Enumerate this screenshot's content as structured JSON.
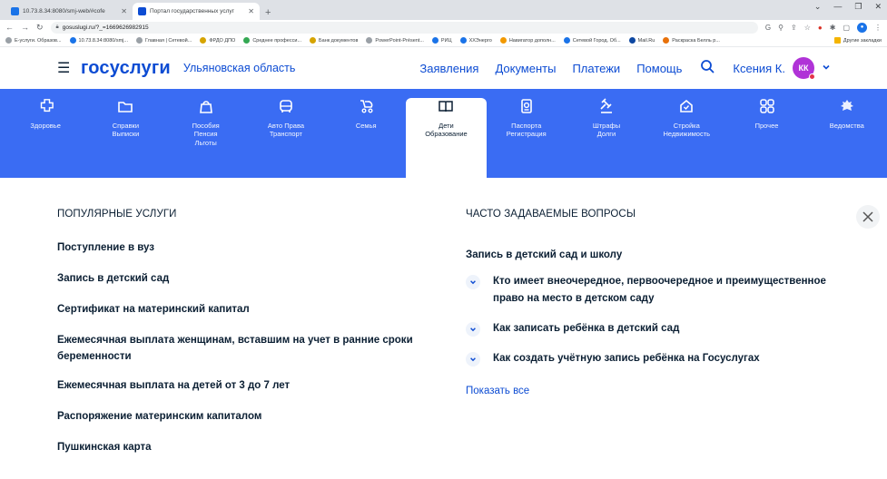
{
  "browser": {
    "tabs": [
      {
        "title": "10.73.8.34:8080/smj-web/#cofe",
        "active": false
      },
      {
        "title": "Портал государственных услуг",
        "active": true
      }
    ],
    "new_tab": "+",
    "url": "gosuslugi.ru/?_=1669626982915",
    "bookmarks": [
      "Е-услуги. Образов...",
      "10.73.8.34:8080/smj...",
      "Главная | Сетевой...",
      "ФРДО ДПО",
      "Среднее професси...",
      "Банк документов",
      "PowerPoint-Présent...",
      "РИЦ",
      "ХХЭнерго",
      "Навигатор дополн...",
      "Сетевой Город. Об...",
      "Mail.Ru",
      "Раскраска Белль р..."
    ],
    "other_bookmarks": "Другие закладки"
  },
  "header": {
    "logo": "госуслуги",
    "region": "Ульяновская область",
    "nav": [
      "Заявления",
      "Документы",
      "Платежи",
      "Помощь"
    ],
    "user_name": "Ксения К.",
    "avatar_initials": "КК"
  },
  "categories": [
    {
      "label": "Здоровье",
      "icon": "health-icon"
    },
    {
      "label": "Справки\nВыписки",
      "icon": "folder-icon"
    },
    {
      "label": "Пособия\nПенсия\nЛьготы",
      "icon": "bag-icon"
    },
    {
      "label": "Авто Права\nТранспорт",
      "icon": "car-icon"
    },
    {
      "label": "Семья",
      "icon": "stroller-icon"
    },
    {
      "label": "Дети\nОбразование",
      "icon": "book-icon",
      "active": true
    },
    {
      "label": "Паспорта\nРегистрация",
      "icon": "passport-icon"
    },
    {
      "label": "Штрафы\nДолги",
      "icon": "gavel-icon"
    },
    {
      "label": "Стройка\nНедвижимость",
      "icon": "home-icon"
    },
    {
      "label": "Прочее",
      "icon": "grid-icon"
    },
    {
      "label": "Ведомства",
      "icon": "emblem-icon"
    }
  ],
  "popular": {
    "title": "ПОПУЛЯРНЫЕ УСЛУГИ",
    "items": [
      "Поступление в вуз",
      "Запись в детский сад",
      "Сертификат на материнский капитал",
      "Ежемесячная выплата женщинам, вставшим на учет в ранние сроки беременности",
      "Ежемесячная выплата на детей от 3 до 7 лет",
      "Распоряжение материнским капиталом",
      "Пушкинская карта"
    ]
  },
  "faq": {
    "title": "ЧАСТО ЗАДАВАЕМЫЕ ВОПРОСЫ",
    "group": "Запись в детский сад и школу",
    "items": [
      "Кто имеет внеочередное, первоочередное и преимущественное право на место в детском саду",
      "Как записать ребёнка в детский сад",
      "Как создать учётную запись ребёнка на Госуслугах"
    ],
    "show_all": "Показать все"
  },
  "colors": {
    "brand": "#0d4cd3",
    "catbar": "#3a6cf3",
    "avatar": "#b033d7"
  }
}
